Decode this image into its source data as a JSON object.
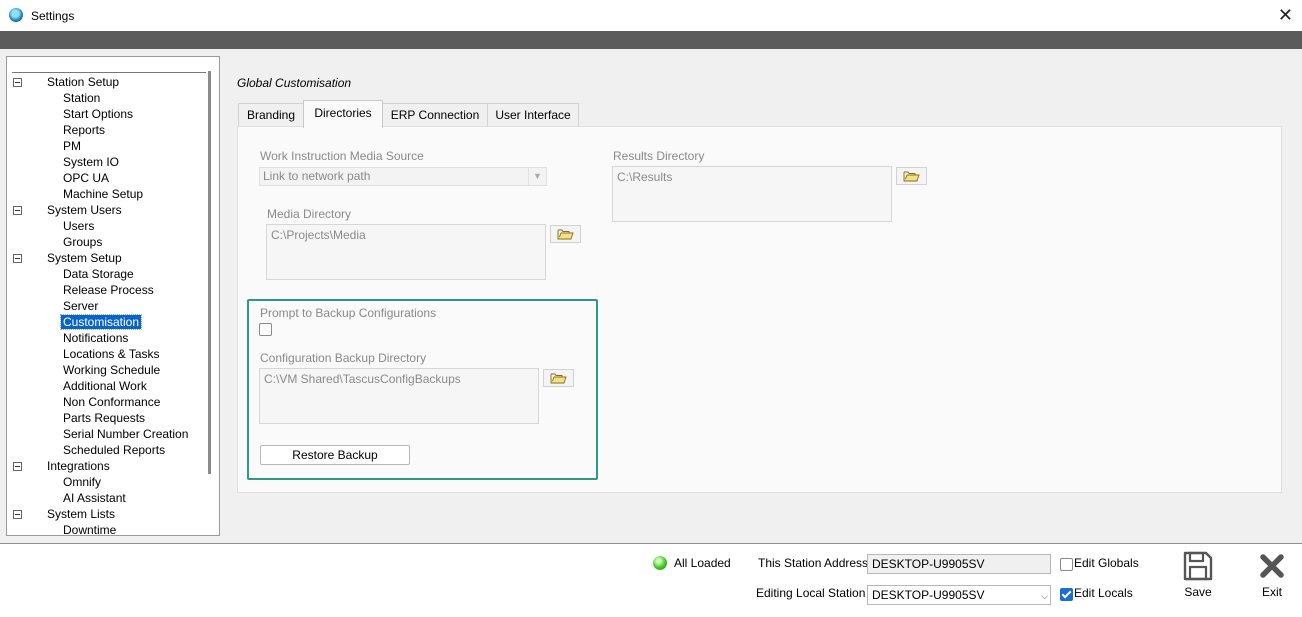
{
  "window": {
    "title": "Settings"
  },
  "tree": {
    "items": [
      {
        "label": "Station Setup",
        "level": 0
      },
      {
        "label": "Station",
        "level": 1
      },
      {
        "label": "Start Options",
        "level": 1
      },
      {
        "label": "Reports",
        "level": 1
      },
      {
        "label": "PM",
        "level": 1
      },
      {
        "label": "System IO",
        "level": 1
      },
      {
        "label": "OPC UA",
        "level": 1
      },
      {
        "label": "Machine Setup",
        "level": 1
      },
      {
        "label": "System Users",
        "level": 0
      },
      {
        "label": "Users",
        "level": 1
      },
      {
        "label": "Groups",
        "level": 1
      },
      {
        "label": "System Setup",
        "level": 0
      },
      {
        "label": "Data Storage",
        "level": 1
      },
      {
        "label": "Release Process",
        "level": 1
      },
      {
        "label": "Server",
        "level": 1
      },
      {
        "label": "Customisation",
        "level": 1,
        "selected": true
      },
      {
        "label": "Notifications",
        "level": 1
      },
      {
        "label": "Locations & Tasks",
        "level": 1
      },
      {
        "label": "Working Schedule",
        "level": 1
      },
      {
        "label": "Additional Work",
        "level": 1
      },
      {
        "label": "Non Conformance",
        "level": 1
      },
      {
        "label": "Parts Requests",
        "level": 1
      },
      {
        "label": "Serial Number Creation",
        "level": 1
      },
      {
        "label": "Scheduled Reports",
        "level": 1
      },
      {
        "label": "Integrations",
        "level": 0
      },
      {
        "label": "Omnify",
        "level": 1
      },
      {
        "label": "AI Assistant",
        "level": 1
      },
      {
        "label": "System Lists",
        "level": 0
      },
      {
        "label": "Downtime",
        "level": 1
      }
    ]
  },
  "main": {
    "section_title": "Global Customisation",
    "tabs": [
      {
        "label": "Branding"
      },
      {
        "label": "Directories",
        "active": true
      },
      {
        "label": "ERP Connection"
      },
      {
        "label": "User Interface"
      }
    ],
    "directories": {
      "media_source_label": "Work Instruction Media Source",
      "media_source_value": "Link to network path",
      "media_dir_label": "Media Directory",
      "media_dir_value": "C:\\Projects\\Media",
      "results_dir_label": "Results Directory",
      "results_dir_value": "C:\\Results",
      "prompt_backup_label": "Prompt to Backup Configurations",
      "prompt_backup_checked": false,
      "config_backup_label": "Configuration Backup Directory",
      "config_backup_value": "C:\\VM Shared\\TascusConfigBackups",
      "restore_button": "Restore Backup"
    }
  },
  "footer": {
    "status": "All Loaded",
    "station_address_label": "This Station Address",
    "station_address_value": "DESKTOP-U9905SV",
    "editing_station_label": "Editing Local Station",
    "editing_station_value": "DESKTOP-U9905SV",
    "edit_globals_label": "Edit Globals",
    "edit_globals_checked": false,
    "edit_locals_label": "Edit Locals",
    "edit_locals_checked": true,
    "save_label": "Save",
    "exit_label": "Exit"
  },
  "colors": {
    "accent_highlight": "#2c9a86",
    "selection": "#0a64c8",
    "status_ok": "#46c22a"
  }
}
